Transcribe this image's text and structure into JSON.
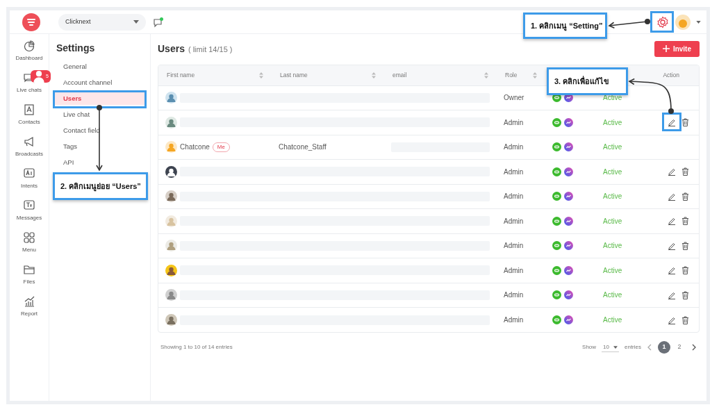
{
  "topbar": {
    "workspace": "Clicknext"
  },
  "nav": [
    {
      "label": "Dashboard"
    },
    {
      "label": "Live chats",
      "badge": "5"
    },
    {
      "label": "Contacts"
    },
    {
      "label": "Broadcasts"
    },
    {
      "label": "Intents"
    },
    {
      "label": "Messages"
    },
    {
      "label": "Menu"
    },
    {
      "label": "Files"
    },
    {
      "label": "Report"
    }
  ],
  "settings": {
    "title": "Settings",
    "items": [
      {
        "label": "General",
        "selected": false
      },
      {
        "label": "Account channel",
        "selected": false
      },
      {
        "label": "Users",
        "selected": true
      },
      {
        "label": "Live chat",
        "selected": false
      },
      {
        "label": "Contact field",
        "selected": false
      },
      {
        "label": "Tags",
        "selected": false
      },
      {
        "label": "API",
        "selected": false
      }
    ]
  },
  "page": {
    "title": "Users",
    "subtitle": "( limit 14/15 )",
    "invite": "Invite"
  },
  "table": {
    "columns": [
      {
        "label": "First name",
        "sortable": true
      },
      {
        "label": "Last name",
        "sortable": true
      },
      {
        "label": "email",
        "sortable": true
      },
      {
        "label": "Role",
        "sortable": true
      },
      {
        "label": "Action",
        "sortable": false
      }
    ],
    "rows": [
      {
        "role": "Owner",
        "status": "Active",
        "actions": false
      },
      {
        "role": "Admin",
        "status": "Active",
        "actions": true
      },
      {
        "first_name": "Chatcone",
        "badge": "Me",
        "last_name": "Chatcone_Staff",
        "role": "Admin",
        "status": "Active",
        "actions": false
      },
      {
        "role": "Admin",
        "status": "Active",
        "actions": true
      },
      {
        "role": "Admin",
        "status": "Active",
        "actions": true
      },
      {
        "role": "Admin",
        "status": "Active",
        "actions": true
      },
      {
        "role": "Admin",
        "status": "Active",
        "actions": true
      },
      {
        "role": "Admin",
        "status": "Active",
        "actions": true
      },
      {
        "role": "Admin",
        "status": "Active",
        "actions": true
      },
      {
        "role": "Admin",
        "status": "Active",
        "actions": true
      }
    ]
  },
  "footer": {
    "summary": "Showing 1 to 10 of 14 entries",
    "show_label": "Show",
    "page_size": "10",
    "entries_label": "entries",
    "pages": [
      {
        "label": "1",
        "selected": true
      },
      {
        "label": "2",
        "selected": false
      }
    ]
  },
  "callouts": [
    {
      "text": "1. คลิกเมนู “Setting”"
    },
    {
      "text": "2. คลิกเมนูย่อย “Users”"
    },
    {
      "text": "3. คลิกเพื่อแก้ไข"
    }
  ]
}
